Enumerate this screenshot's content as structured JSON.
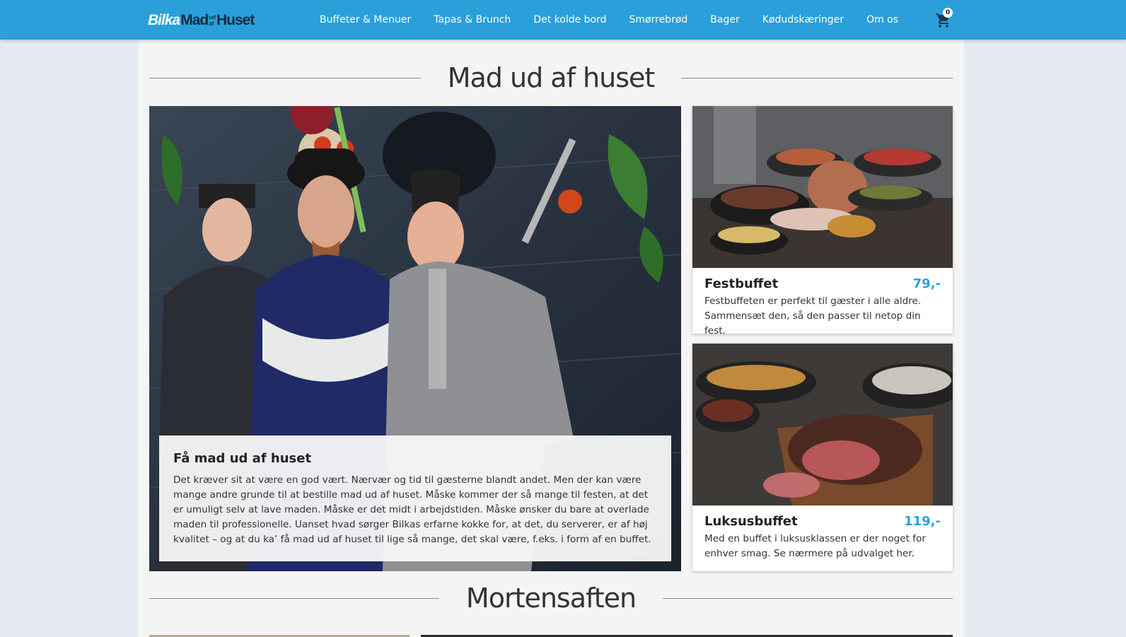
{
  "header": {
    "logo": {
      "part1": "Bilka",
      "part2": "Mad",
      "small_top": "ud",
      "small_bottom": "af",
      "part3": "Huset"
    },
    "nav": [
      {
        "label": "Buffeter & Menuer"
      },
      {
        "label": "Tapas & Brunch"
      },
      {
        "label": "Det kolde bord"
      },
      {
        "label": "Smørrebrød"
      },
      {
        "label": "Bager"
      },
      {
        "label": "Kødudskæringer"
      },
      {
        "label": "Om os"
      }
    ],
    "cart": {
      "icon": "shopping-cart-icon",
      "count": "0"
    }
  },
  "main": {
    "section1_title": "Mad ud af huset",
    "hero": {
      "image": "chefs-photo",
      "title": "Få mad ud af huset",
      "text": "Det kræver sit at være en god vært. Nærvær og tid til gæsterne blandt andet. Men der kan være mange andre grunde til at bestille mad ud af huset. Måske kommer der så mange til festen, at det er umuligt selv at lave maden. Måske er det midt i arbejdstiden. Måske ønsker du bare at overlade maden til professionelle. Uanset hvad sørger Bilkas erfarne kokke for, at det, du serverer, er af høj kvalitet – og at du ka’ få mad ud af huset til lige så mange, det skal være, f.eks. i form af en buffet."
    },
    "products": [
      {
        "title": "Festbuffet",
        "price": "79,-",
        "desc": "Festbuffeten er perfekt til gæster i alle aldre. Sammensæt den, så den passer til netop din fest."
      },
      {
        "title": "Luksusbuffet",
        "price": "119,-",
        "desc": "Med en buffet i luksusklassen er der noget for enhver smag. Se nærmere på udvalget her."
      }
    ],
    "section2_title": "Mortensaften"
  },
  "colors": {
    "brand": "#2b9fd9",
    "price": "#2b9fd9",
    "logo_dark": "#102c44"
  }
}
